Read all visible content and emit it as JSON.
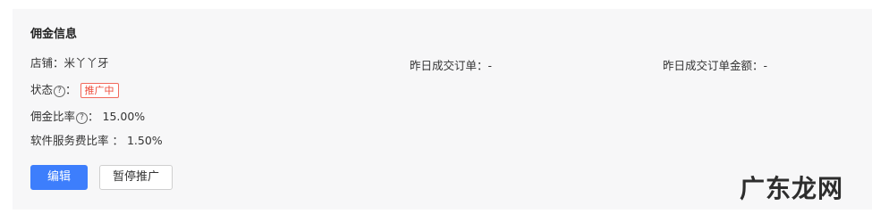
{
  "section": {
    "title": "佣金信息"
  },
  "shop": {
    "label": "店铺：",
    "value": "米丫丫牙"
  },
  "status": {
    "label": "状态",
    "help_icon": "?",
    "colon": "：",
    "badge": "推广中",
    "badge_color": "#ee4a39"
  },
  "commission": {
    "label": "佣金比率",
    "help_icon": "?",
    "colon": "：",
    "value": "15.00%"
  },
  "service_fee": {
    "label": "软件服务费比率 ：",
    "value": "1.50%"
  },
  "yesterday_orders": {
    "label": "昨日成交订单：",
    "value": "-"
  },
  "yesterday_amount": {
    "label": "昨日成交订单金额：",
    "value": "-"
  },
  "buttons": {
    "edit": "编辑",
    "pause": "暂停推广",
    "primary_color": "#3d7efc"
  },
  "watermark": {
    "text": "广东龙网"
  }
}
